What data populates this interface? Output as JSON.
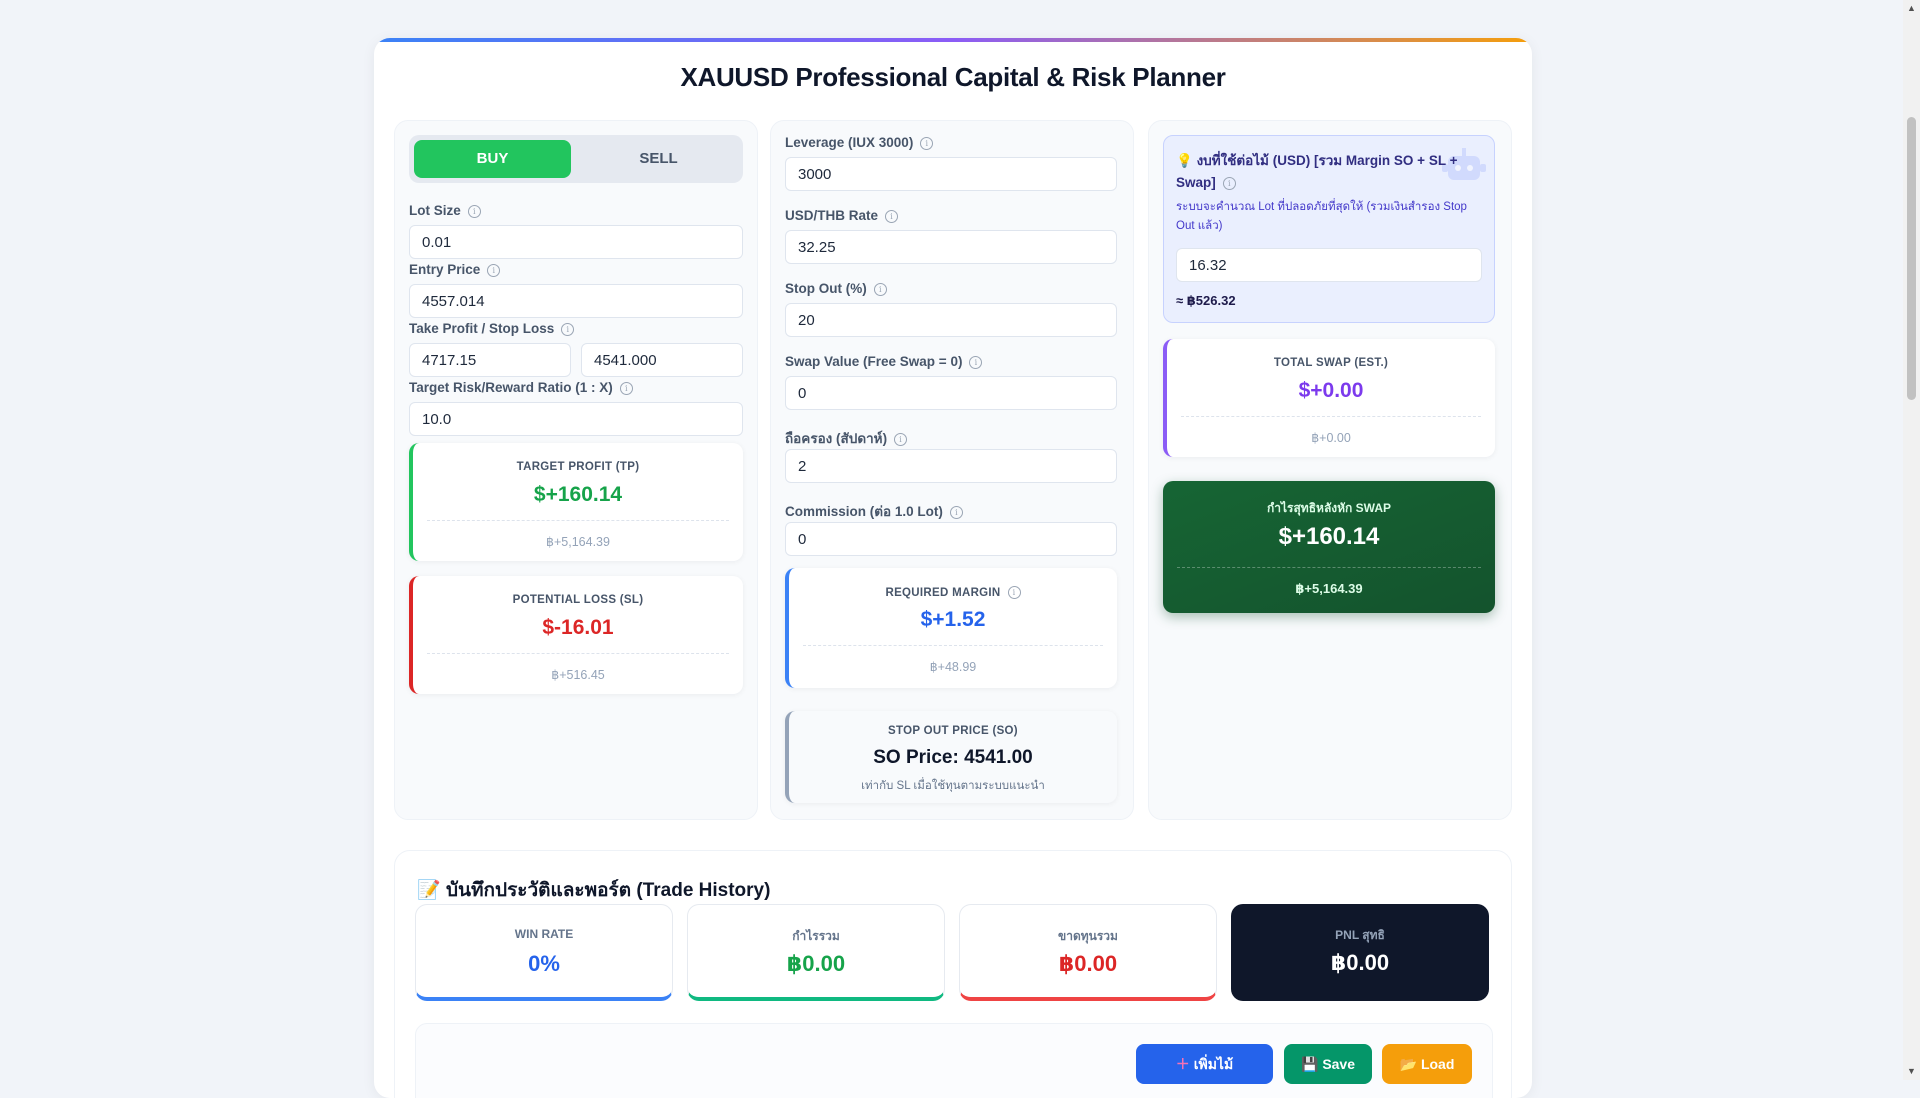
{
  "title": "XAUUSD Professional Capital & Risk Planner",
  "toggle": {
    "buy": "BUY",
    "sell": "SELL",
    "selected": "BUY"
  },
  "left": {
    "lot_label": "Lot Size",
    "lot_value": "0.01",
    "entry_label": "Entry Price",
    "entry_value": "4557.014",
    "tpsl_label": "Take Profit / Stop Loss",
    "tp_value": "4717.15",
    "sl_value": "4541.000",
    "rr_label": "Target Risk/Reward Ratio (1 : X)",
    "rr_value": "10.0",
    "tp_card": {
      "label": "TARGET PROFIT (TP)",
      "usd": "$+160.14",
      "thb": "฿+5,164.39"
    },
    "sl_card": {
      "label": "POTENTIAL LOSS (SL)",
      "usd": "$-16.01",
      "thb": "฿+516.45"
    }
  },
  "middle": {
    "leverage_label": "Leverage (IUX 3000)",
    "leverage_value": "3000",
    "usdthb_label": "USD/THB Rate",
    "usdthb_value": "32.25",
    "stopout_label": "Stop Out (%)",
    "stopout_value": "20",
    "swap_label": "Swap Value (Free Swap = 0)",
    "swap_value": "0",
    "hold_label": "ถือครอง (สัปดาห์)",
    "hold_value": "2",
    "commission_label": "Commission (ต่อ 1.0 Lot)",
    "commission_value": "0",
    "margin_card": {
      "label": "REQUIRED MARGIN",
      "usd": "$+1.52",
      "thb": "฿+48.99"
    },
    "so_card": {
      "label": "STOP OUT PRICE (SO)",
      "price": "SO Price: 4541.00",
      "note": "เท่ากับ SL เมื่อใช้ทุนตามระบบแนะนำ"
    }
  },
  "right": {
    "budget": {
      "icon": "💡",
      "title": "งบที่ใช้ต่อไม้ (USD) [รวม Margin SO + SL + Swap]",
      "desc": "ระบบจะคำนวณ Lot ที่ปลอดภัยที่สุดให้ (รวมเงินสำรอง Stop Out แล้ว)",
      "value": "16.32",
      "thb": "≈ ฿526.32"
    },
    "swap_card": {
      "label": "TOTAL SWAP (EST.)",
      "usd": "$+0.00",
      "thb": "฿+0.00"
    },
    "net_card": {
      "label": "กำไรสุทธิหลังหัก SWAP",
      "usd": "$+160.14",
      "thb": "฿+5,164.39"
    }
  },
  "history": {
    "icon": "📝",
    "title": "บันทึกประวัติและพอร์ต (Trade History)",
    "stats": [
      {
        "label": "WIN RATE",
        "value": "0%"
      },
      {
        "label": "กำไรรวม",
        "value": "฿0.00"
      },
      {
        "label": "ขาดทุนรวม",
        "value": "฿0.00"
      },
      {
        "label": "PNL สุทธิ",
        "value": "฿0.00"
      }
    ],
    "buttons": {
      "add": "เพิ่มไม้",
      "save": "Save",
      "load": "Load"
    }
  },
  "colors": {
    "buy": "#22c55e",
    "profit": "#16a34a",
    "loss": "#dc2626",
    "margin": "#2563eb",
    "swap": "#7c3aed",
    "net_bg": "#166534",
    "add_btn": "#2563eb",
    "save_btn": "#059669",
    "load_btn": "#f59e0b"
  }
}
